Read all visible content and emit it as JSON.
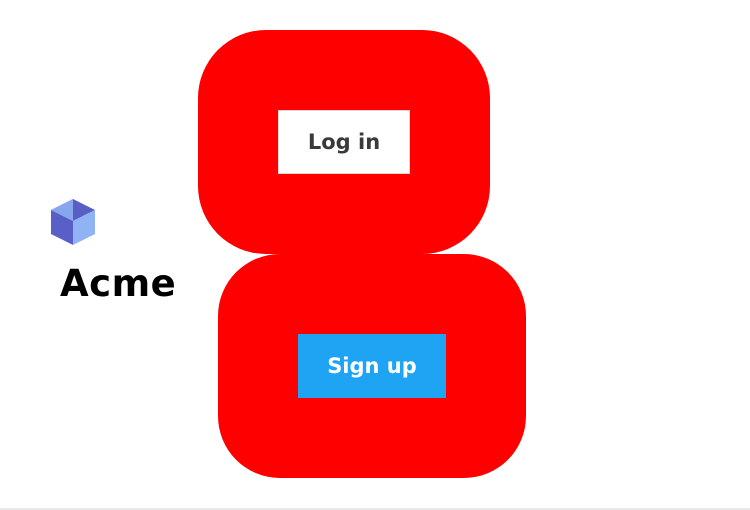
{
  "brand": {
    "name": "Acme",
    "logo_icon": "cube-icon"
  },
  "actions": {
    "login_label": "Log in",
    "signup_label": "Sign up"
  },
  "colors": {
    "panel": "#ff0000",
    "signup_button": "#1fa4f4",
    "login_button": "#ffffff",
    "logo_left": "#5a5fc7",
    "logo_right": "#8fb3f5"
  }
}
